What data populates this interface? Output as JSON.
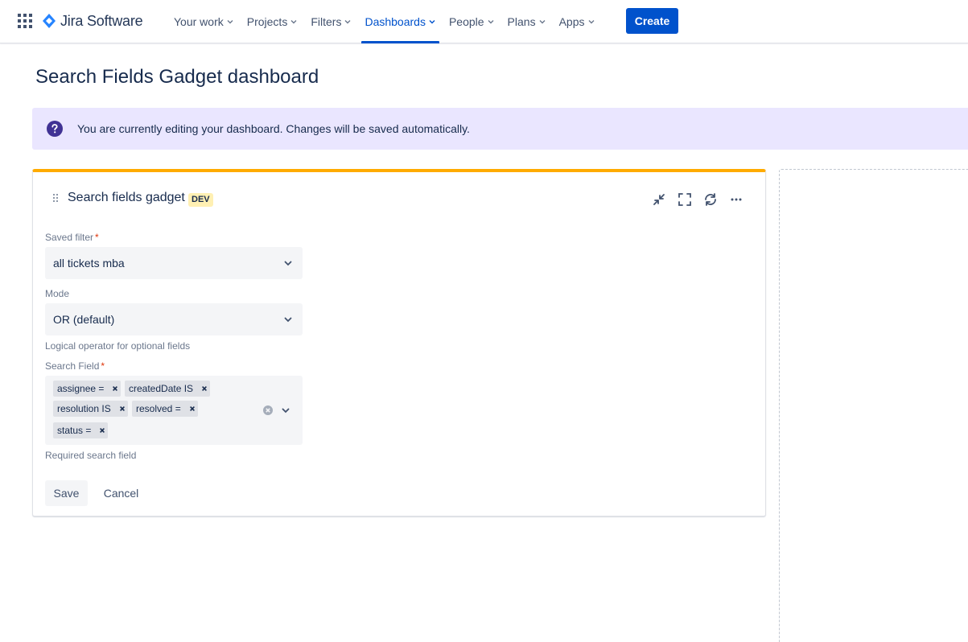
{
  "nav": {
    "product": "Jira Software",
    "items": [
      {
        "label": "Your work",
        "active": false
      },
      {
        "label": "Projects",
        "active": false
      },
      {
        "label": "Filters",
        "active": false
      },
      {
        "label": "Dashboards",
        "active": true
      },
      {
        "label": "People",
        "active": false
      },
      {
        "label": "Plans",
        "active": false
      },
      {
        "label": "Apps",
        "active": false
      }
    ],
    "create_label": "Create"
  },
  "page": {
    "title": "Search Fields Gadget dashboard"
  },
  "banner": {
    "text": "You are currently editing your dashboard. Changes will be saved automatically.",
    "icon": "question-circle-icon"
  },
  "gadget": {
    "title": "Search fields gadget",
    "lozenge": "DEV",
    "actions": [
      "minimize-icon",
      "fullscreen-icon",
      "refresh-icon",
      "more-icon"
    ],
    "saved_filter": {
      "label": "Saved filter",
      "required_mark": "*",
      "value": "all tickets mba"
    },
    "mode": {
      "label": "Mode",
      "value": "OR (default)",
      "help": "Logical operator for optional fields"
    },
    "search_field": {
      "label": "Search Field",
      "required_mark": "*",
      "tags": [
        "assignee =",
        "createdDate IS",
        "resolution IS",
        "resolved =",
        "status ="
      ],
      "help": "Required search field"
    },
    "save_label": "Save",
    "cancel_label": "Cancel"
  },
  "colors": {
    "primary": "#0052cc",
    "gadget_top_border": "#ffab00",
    "banner_bg": "#eae6ff",
    "banner_icon": "#403294",
    "lozenge_bg": "#fff0b3",
    "required": "#de350b"
  }
}
